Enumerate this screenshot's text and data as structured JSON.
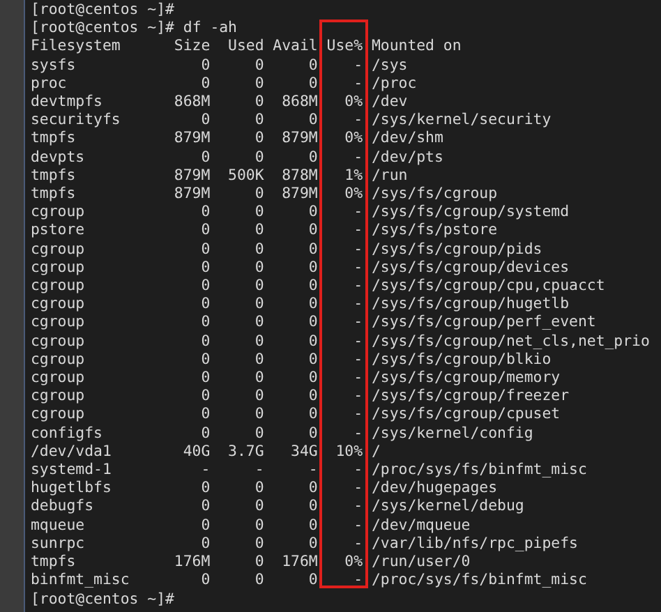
{
  "terminal": {
    "lines_before": [
      "[root@centos ~]#",
      "[root@centos ~]# df -ah"
    ],
    "columns": [
      "Filesystem",
      "Size",
      "Used",
      "Avail",
      "Use%",
      "Mounted on"
    ],
    "rows": [
      [
        "sysfs",
        "0",
        "0",
        "0",
        "-",
        "/sys"
      ],
      [
        "proc",
        "0",
        "0",
        "0",
        "-",
        "/proc"
      ],
      [
        "devtmpfs",
        "868M",
        "0",
        "868M",
        "0%",
        "/dev"
      ],
      [
        "securityfs",
        "0",
        "0",
        "0",
        "-",
        "/sys/kernel/security"
      ],
      [
        "tmpfs",
        "879M",
        "0",
        "879M",
        "0%",
        "/dev/shm"
      ],
      [
        "devpts",
        "0",
        "0",
        "0",
        "-",
        "/dev/pts"
      ],
      [
        "tmpfs",
        "879M",
        "500K",
        "878M",
        "1%",
        "/run"
      ],
      [
        "tmpfs",
        "879M",
        "0",
        "879M",
        "0%",
        "/sys/fs/cgroup"
      ],
      [
        "cgroup",
        "0",
        "0",
        "0",
        "-",
        "/sys/fs/cgroup/systemd"
      ],
      [
        "pstore",
        "0",
        "0",
        "0",
        "-",
        "/sys/fs/pstore"
      ],
      [
        "cgroup",
        "0",
        "0",
        "0",
        "-",
        "/sys/fs/cgroup/pids"
      ],
      [
        "cgroup",
        "0",
        "0",
        "0",
        "-",
        "/sys/fs/cgroup/devices"
      ],
      [
        "cgroup",
        "0",
        "0",
        "0",
        "-",
        "/sys/fs/cgroup/cpu,cpuacct"
      ],
      [
        "cgroup",
        "0",
        "0",
        "0",
        "-",
        "/sys/fs/cgroup/hugetlb"
      ],
      [
        "cgroup",
        "0",
        "0",
        "0",
        "-",
        "/sys/fs/cgroup/perf_event"
      ],
      [
        "cgroup",
        "0",
        "0",
        "0",
        "-",
        "/sys/fs/cgroup/net_cls,net_prio"
      ],
      [
        "cgroup",
        "0",
        "0",
        "0",
        "-",
        "/sys/fs/cgroup/blkio"
      ],
      [
        "cgroup",
        "0",
        "0",
        "0",
        "-",
        "/sys/fs/cgroup/memory"
      ],
      [
        "cgroup",
        "0",
        "0",
        "0",
        "-",
        "/sys/fs/cgroup/freezer"
      ],
      [
        "cgroup",
        "0",
        "0",
        "0",
        "-",
        "/sys/fs/cgroup/cpuset"
      ],
      [
        "configfs",
        "0",
        "0",
        "0",
        "-",
        "/sys/kernel/config"
      ],
      [
        "/dev/vda1",
        "40G",
        "3.7G",
        "34G",
        "10%",
        "/"
      ],
      [
        "systemd-1",
        "-",
        "-",
        "-",
        "-",
        "/proc/sys/fs/binfmt_misc"
      ],
      [
        "hugetlbfs",
        "0",
        "0",
        "0",
        "-",
        "/dev/hugepages"
      ],
      [
        "debugfs",
        "0",
        "0",
        "0",
        "-",
        "/sys/kernel/debug"
      ],
      [
        "mqueue",
        "0",
        "0",
        "0",
        "-",
        "/dev/mqueue"
      ],
      [
        "sunrpc",
        "0",
        "0",
        "0",
        "-",
        "/var/lib/nfs/rpc_pipefs"
      ],
      [
        "tmpfs",
        "176M",
        "0",
        "176M",
        "0%",
        "/run/user/0"
      ],
      [
        "binfmt_misc",
        "0",
        "0",
        "0",
        "-",
        "/proc/sys/fs/binfmt_misc"
      ]
    ],
    "prompt": "[root@centos ~]#"
  }
}
